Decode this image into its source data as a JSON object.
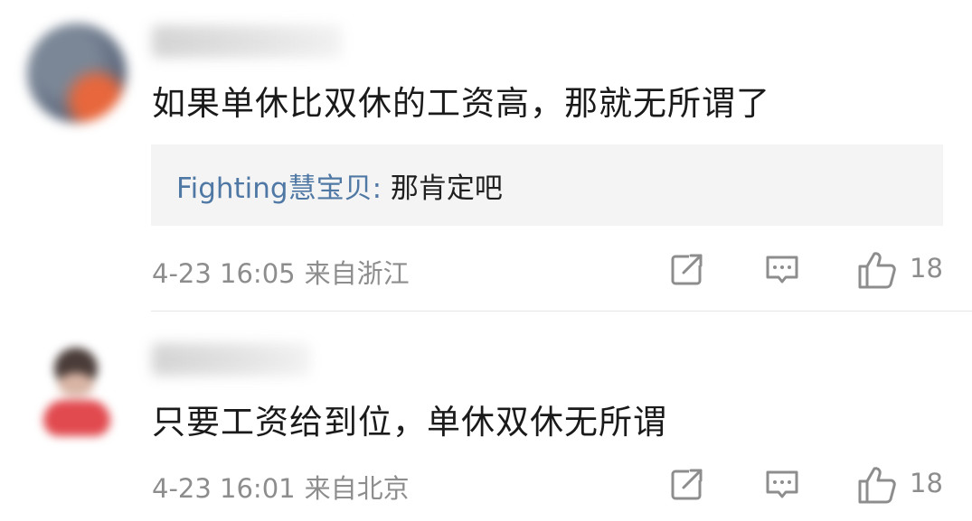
{
  "comments": [
    {
      "text": "如果单休比双休的工资高，那就无所谓了",
      "reply": {
        "author": "Fighting慧宝贝",
        "separator": ":",
        "text": " 那肯定吧"
      },
      "date": "4-23 16:05",
      "location": "来自浙江",
      "likes": "18"
    },
    {
      "text": "只要工资给到位，单休双休无所谓",
      "date": "4-23 16:01",
      "location": "来自北京",
      "likes": "18"
    }
  ],
  "icons": {
    "share": "share-icon",
    "comment": "comment-icon",
    "like": "thumbs-up-icon"
  },
  "colors": {
    "reply_author": "#4f78a4",
    "meta_text": "#8d8d8d",
    "reply_bg": "#f4f4f5"
  }
}
